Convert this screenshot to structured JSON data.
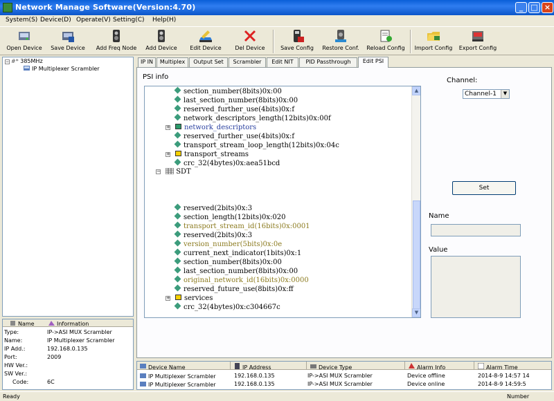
{
  "window": {
    "title": "Network Manage Software(Version:4.70)",
    "controls": [
      "_",
      "□",
      "×"
    ]
  },
  "menu": [
    "System(S)",
    "Device(D)",
    "Operate(V)",
    "Setting(C)",
    "Help(H)"
  ],
  "toolbar": [
    "Open Device",
    "Save Device",
    "Add Freq Node",
    "Add Device",
    "Edit Device",
    "Del Device",
    "Save Config",
    "Restore Conf.",
    "Reload Config",
    "Import Config",
    "Export Config"
  ],
  "left_tree": {
    "root": "385MHz",
    "child": "IP Multiplexer Scrambler"
  },
  "props": {
    "headers": [
      "Name",
      "Information"
    ],
    "rows": [
      {
        "name": "Type:",
        "value": "IP->ASI MUX Scrambler"
      },
      {
        "name": "Name:",
        "value": "IP Multiplexer Scrambler"
      },
      {
        "name": "IP Add.:",
        "value": "192.168.0.135"
      },
      {
        "name": "Port:",
        "value": "2009"
      },
      {
        "name": "HW Ver.:",
        "value": ""
      },
      {
        "name": "SW Ver.:",
        "value": ""
      },
      {
        "name": "Code:",
        "value": "6C"
      }
    ]
  },
  "tabs": [
    "IP IN",
    "Multiplex",
    "Output Set",
    "Scrambler",
    "Edit NIT",
    "PID Passthrough",
    "Edit PSI"
  ],
  "psi": {
    "label": "PSI info",
    "tree_top": [
      {
        "text": "section_number(8bits)0x:00",
        "kind": "leaf"
      },
      {
        "text": "last_section_number(8bits)0x:00",
        "kind": "leaf"
      },
      {
        "text": "reserved_further_use(4bits)0x:f",
        "kind": "leaf"
      },
      {
        "text": "network_descriptors_length(12bits)0x:00f",
        "kind": "leaf"
      },
      {
        "text": "network_descriptors",
        "kind": "node",
        "blue": true
      },
      {
        "text": "reserved_further_use(4bits)0x:f",
        "kind": "leaf"
      },
      {
        "text": "transport_stream_loop_length(12bits)0x:04c",
        "kind": "leaf"
      },
      {
        "text": "transport_streams",
        "kind": "node"
      },
      {
        "text": "crc_32(4bytes)0x:aea51bcd",
        "kind": "leaf"
      }
    ],
    "sdt": "SDT",
    "tree_bottom": [
      {
        "text": "reserved(2bits)0x:3",
        "kind": "leaf"
      },
      {
        "text": "section_length(12bits)0x:020",
        "kind": "leaf"
      },
      {
        "text": "transport_stream_id(16bits)0x:0001",
        "kind": "leaf",
        "hl": true
      },
      {
        "text": "reserved(2bits)0x:3",
        "kind": "leaf"
      },
      {
        "text": "version_number(5bits)0x:0e",
        "kind": "leaf",
        "hl": true
      },
      {
        "text": "current_next_indicator(1bits)0x:1",
        "kind": "leaf"
      },
      {
        "text": "section_number(8bits)0x:00",
        "kind": "leaf"
      },
      {
        "text": "last_section_number(8bits)0x:00",
        "kind": "leaf"
      },
      {
        "text": "original_network_id(16bits)0x:0000",
        "kind": "leaf",
        "hl": true
      },
      {
        "text": "reserved_future_use(8bits)0x:ff",
        "kind": "leaf"
      },
      {
        "text": "services",
        "kind": "node"
      },
      {
        "text": "crc_32(4bytes)0x:c304667c",
        "kind": "leaf"
      }
    ],
    "channel_label": "Channel:",
    "channel_value": "Channel-1",
    "set_label": "Set",
    "name_label": "Name",
    "value_label": "Value"
  },
  "devices": {
    "headers": [
      "Device Name",
      "IP Address",
      "Device Type",
      "Alarm Info",
      "Alarm Time"
    ],
    "rows": [
      {
        "name": "IP Multiplexer Scrambler",
        "ip": "192.168.0.135",
        "type": "IP->ASI MUX Scrambler",
        "alarm": "Device offline",
        "time": "2014-8-9 14:57 14"
      },
      {
        "name": "IP Multiplexer Scrambler",
        "ip": "192.168.0.135",
        "type": "IP->ASI MUX Scrambler",
        "alarm": "Device online",
        "time": "2014-8-9 14:59:5"
      }
    ]
  },
  "status": {
    "left": "Ready",
    "right": "Number"
  }
}
